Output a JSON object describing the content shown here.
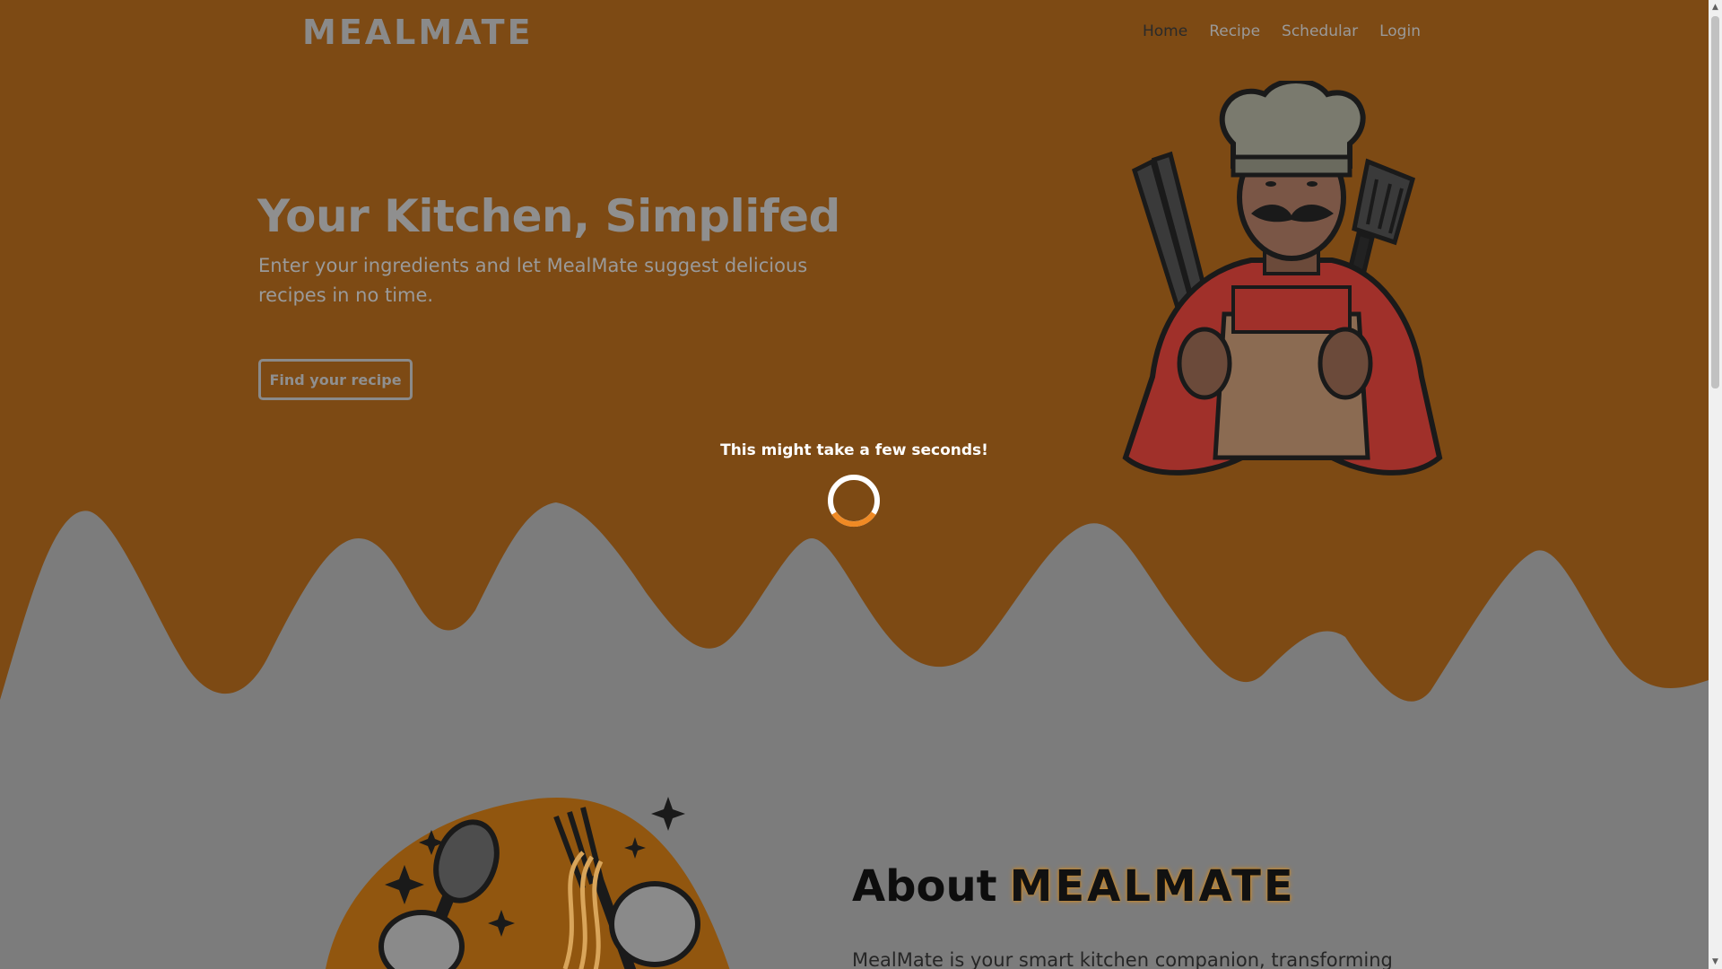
{
  "header": {
    "logo": "MEALMATE",
    "nav": [
      {
        "label": "Home"
      },
      {
        "label": "Recipe"
      },
      {
        "label": "Schedular"
      },
      {
        "label": "Login"
      }
    ]
  },
  "hero": {
    "title": "Your Kitchen, Simplifed",
    "subtitle": "Enter your ingredients and let MealMate suggest delicious recipes in no time.",
    "button_label": "Find your recipe"
  },
  "loader": {
    "message": "This might take a few seconds!"
  },
  "about": {
    "title_prefix": "About",
    "title_brand": "MEALMATE",
    "text": "MealMate is your smart kitchen companion, transforming"
  },
  "colors": {
    "hero_bg": "#7d4a14",
    "overlay_gray": "#7c7c7c",
    "accent_orange": "#f08a24"
  },
  "icons": {
    "chef": "chef-illustration",
    "spinner": "loading-spinner-icon",
    "about": "utensils-illustration"
  }
}
